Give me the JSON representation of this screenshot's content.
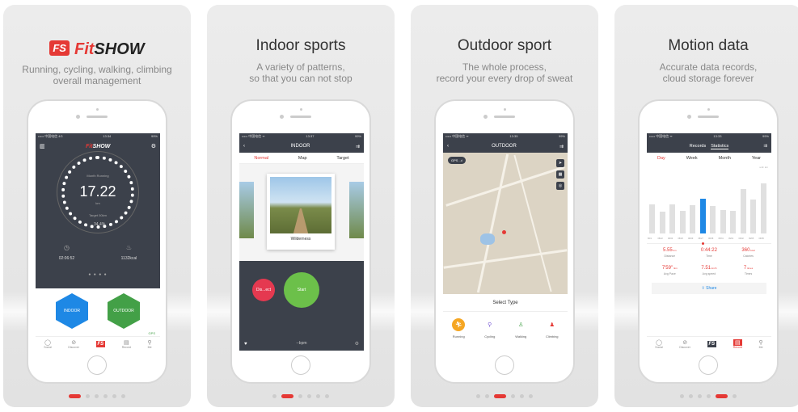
{
  "cards": [
    {
      "title": "",
      "logo": {
        "badge": "FS",
        "fit": "Fit",
        "show": "SHOW"
      },
      "sub": [
        "Running, cycling, walking, climbing",
        "overall management"
      ]
    },
    {
      "title": "Indoor sports",
      "sub": [
        "A variety of patterns,",
        "so that you can not stop"
      ]
    },
    {
      "title": "Outdoor sport",
      "sub": [
        "The whole process,",
        "record your every drop of sweat"
      ]
    },
    {
      "title": "Motion data",
      "sub": [
        "Accurate data records,",
        "cloud storage forever"
      ]
    }
  ],
  "status": {
    "carrier": "••••• 中国电信 4G",
    "time": "13:34",
    "batt": "99%"
  },
  "status2": {
    "carrier": "••••• 中国电信 ᯤ",
    "time": "13:37",
    "batt": "99%"
  },
  "status3": {
    "carrier": "••••• 中国电信 ᯤ",
    "time": "13:35",
    "batt": "99%"
  },
  "status4": {
    "carrier": "••••• 中国电信 ᯤ",
    "time": "13:33",
    "batt": "99%"
  },
  "s1": {
    "brand_fit": "Fit",
    "brand_show": "SHOW",
    "month_label": "Month Running",
    "value": "17.22",
    "unit": "km",
    "target": "Target 50km",
    "pct": "34.4%",
    "duration": "02:06:52",
    "kcal": "1132kcal",
    "page": "● ● ● ●",
    "indoor": "INDOOR",
    "outdoor": "OUTDOOR",
    "gps": "GPS"
  },
  "tabs1": [
    "Social",
    "Discover",
    "",
    "Record",
    "Me"
  ],
  "s2": {
    "nav": "INDOOR",
    "tabs": [
      "Normal",
      "Map",
      "Target"
    ],
    "caption": "Wilderness",
    "dis": "Dis...ect",
    "start": "Start",
    "bpm": "--bpm"
  },
  "s3": {
    "nav": "OUTDOOR",
    "gps": "GPS ..ıl",
    "select": "Select Type",
    "types": [
      "Running",
      "Cycling",
      "Walking",
      "Climbing"
    ]
  },
  "s4": {
    "tabs": [
      "Records",
      "Statistics"
    ],
    "seg": [
      "Day",
      "Week",
      "Month",
      "Year"
    ],
    "unit": "unit: km",
    "bars": [
      0.52,
      0.38,
      0.52,
      0.4,
      0.5,
      0.62,
      0.48,
      0.42,
      0.4,
      0.78,
      0.6,
      0.88
    ],
    "labels": [
      "8/19",
      "08/22",
      "08/24",
      "08/26",
      "08/29",
      "08/27",
      "08/28",
      "08/31",
      "09/01",
      "09/02",
      "09/05",
      "09/05"
    ],
    "highlight": 5,
    "cells": [
      {
        "v": "5.55",
        "u": "km",
        "l": "Distance"
      },
      {
        "v": "0:44:22",
        "u": "",
        "l": "Time"
      },
      {
        "v": "360",
        "u": "kcal",
        "l": "Calories"
      },
      {
        "v": "7'59\"",
        "u": "/km",
        "l": "Avg Pace"
      },
      {
        "v": "7.51",
        "u": "km/h",
        "l": "Avg speed"
      },
      {
        "v": "7",
        "u": "times",
        "l": "Times"
      }
    ],
    "share": "Share"
  },
  "tabs4": [
    "Social",
    "Discover",
    "",
    "Record",
    "Me"
  ],
  "active_dot": [
    0,
    1,
    2,
    4
  ]
}
